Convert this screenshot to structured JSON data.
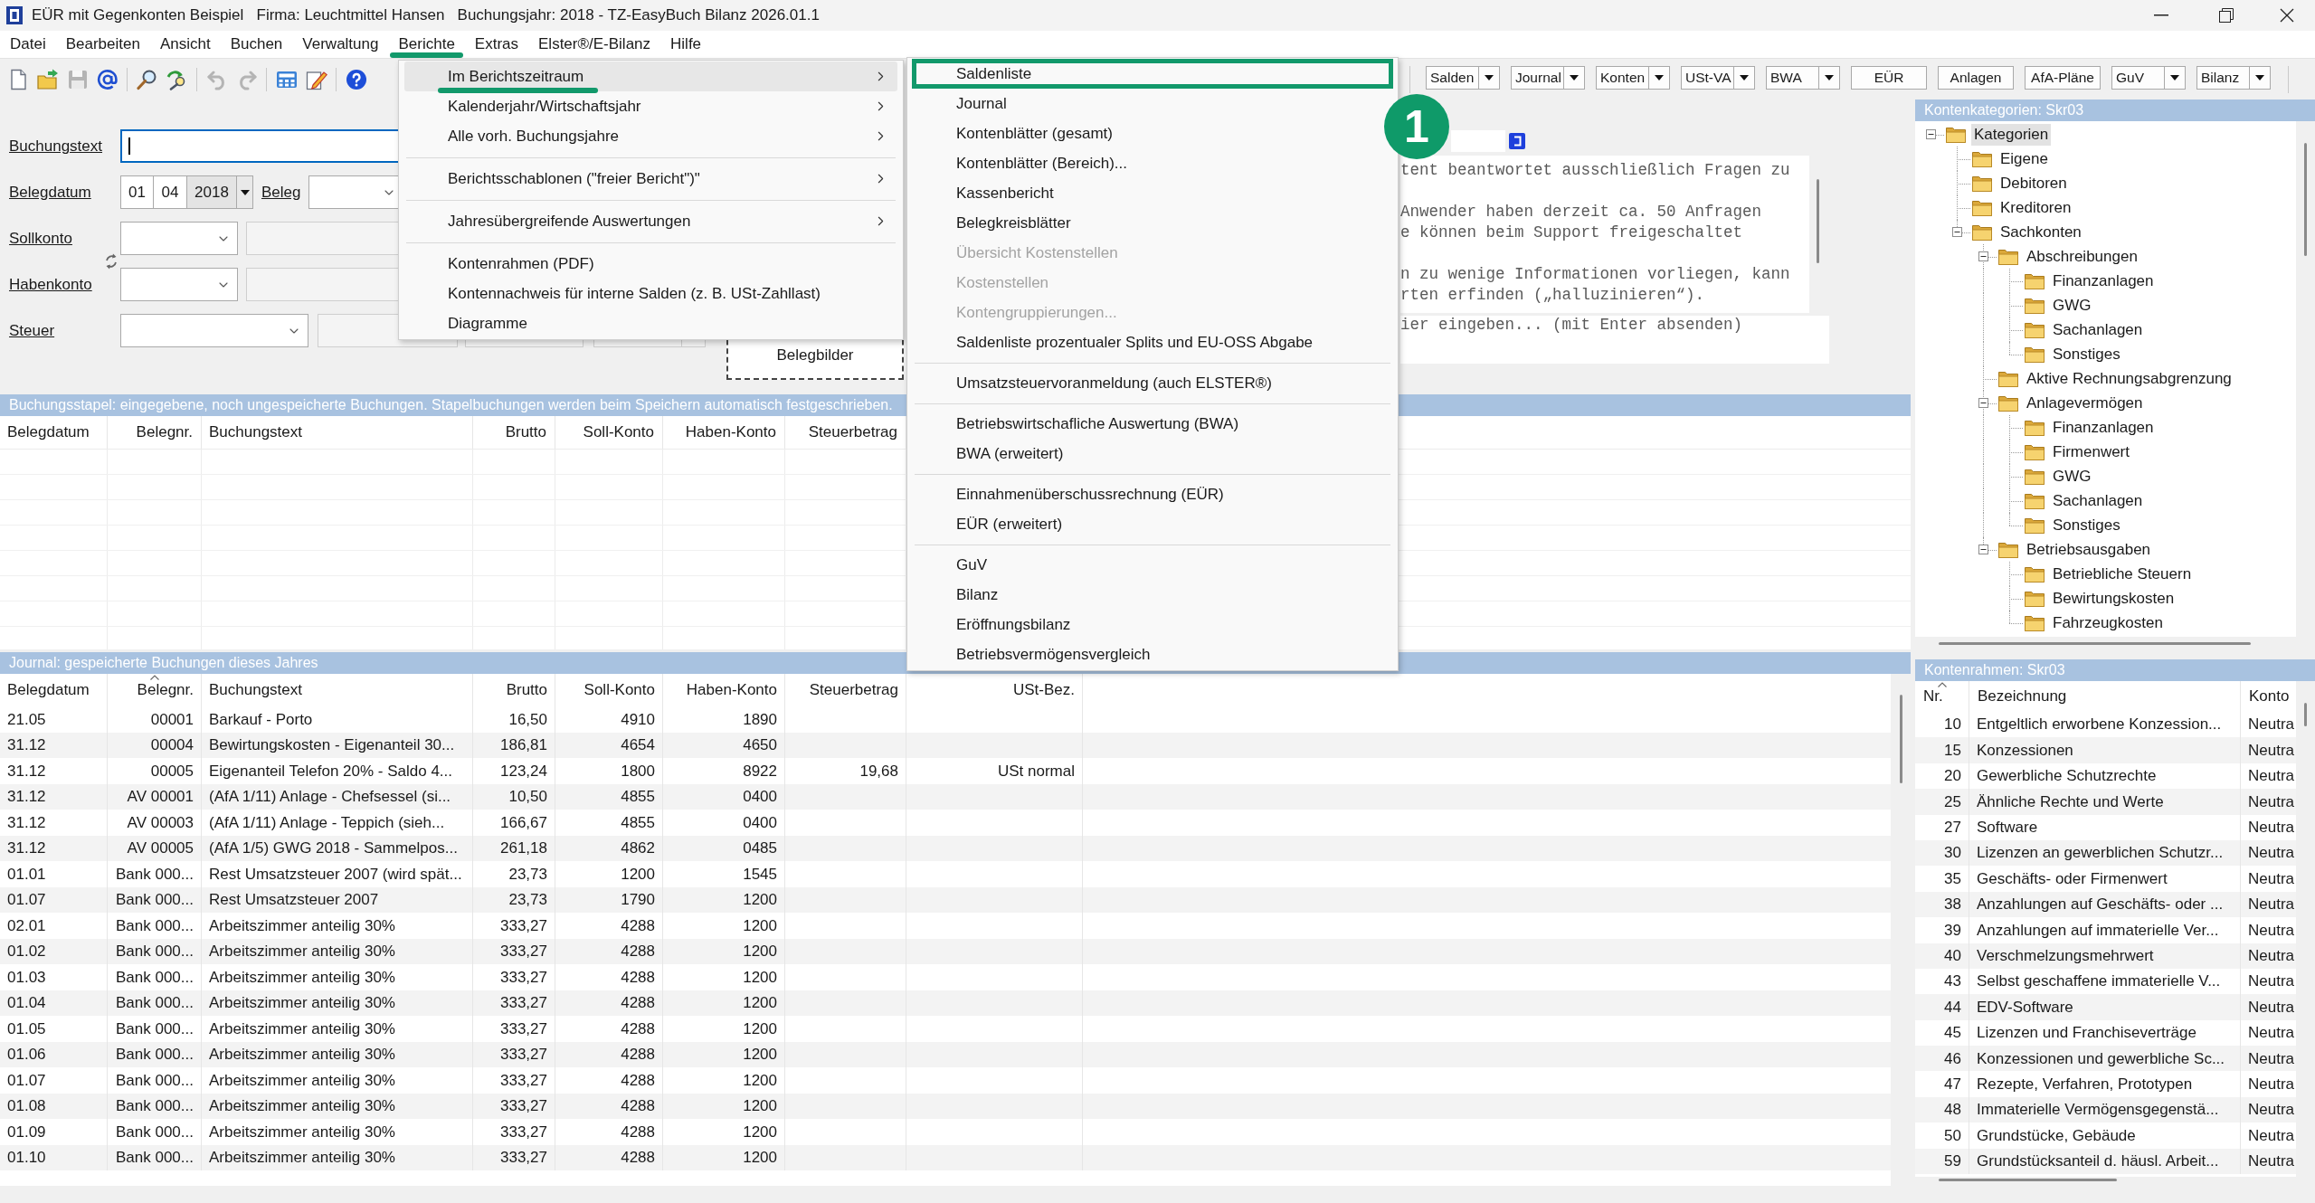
{
  "window": {
    "title": "EÜR mit Gegenkonten Beispiel   Firma: Leuchtmittel Hansen   Buchungsjahr: 2018 - TZ-EasyBuch Bilanz 2026.01.1"
  },
  "menubar": [
    {
      "label": "Datei",
      "marked": false
    },
    {
      "label": "Bearbeiten",
      "marked": false
    },
    {
      "label": "Ansicht",
      "marked": false
    },
    {
      "label": "Buchen",
      "marked": false
    },
    {
      "label": "Verwaltung",
      "marked": false
    },
    {
      "label": "Berichte",
      "marked": true
    },
    {
      "label": "Extras",
      "marked": false
    },
    {
      "label": "Elster®/E-Bilanz",
      "marked": false
    },
    {
      "label": "Hilfe",
      "marked": false
    }
  ],
  "toolbar": [
    [
      {
        "kind": "new",
        "disabled": false
      },
      {
        "kind": "open",
        "disabled": false
      },
      {
        "kind": "save",
        "disabled": true
      },
      {
        "kind": "email",
        "disabled": false
      }
    ],
    [
      {
        "kind": "find",
        "disabled": false
      },
      {
        "kind": "wizard",
        "disabled": false
      }
    ],
    [
      {
        "kind": "undo",
        "disabled": true
      },
      {
        "kind": "redo",
        "disabled": true
      }
    ],
    [
      {
        "kind": "calculator",
        "disabled": false
      },
      {
        "kind": "edit",
        "disabled": false
      }
    ],
    [
      {
        "kind": "help",
        "disabled": false
      }
    ]
  ],
  "report_buttons": [
    {
      "label": "Salden",
      "dropdown": true
    },
    {
      "label": "Journal",
      "dropdown": true
    },
    {
      "label": "Konten",
      "dropdown": true
    },
    {
      "label": "USt-VA",
      "dropdown": true
    },
    {
      "label": "BWA",
      "dropdown": true
    },
    {
      "label": "EÜR",
      "dropdown": false
    },
    {
      "label": "Anlagen",
      "dropdown": false
    },
    {
      "label": "AfA-Pläne",
      "dropdown": false
    },
    {
      "label": "GuV",
      "dropdown": true
    },
    {
      "label": "Bilanz",
      "dropdown": true
    }
  ],
  "form": {
    "booking_text": {
      "label": "Buchungstext",
      "focused": true
    },
    "receipt_date": {
      "label": "Belegdatum",
      "day": "01",
      "month": "04",
      "year": "2018"
    },
    "receipt": {
      "label": "Beleg"
    },
    "debit_account": {
      "label": "Sollkonto"
    },
    "credit_account": {
      "label": "Habenkonto"
    },
    "tax": {
      "label": "Steuer"
    },
    "receipt_images": {
      "label": "Belegbilder"
    }
  },
  "assistant": {
    "paragraphs": [
      [
        "tent beantwortet ausschließlich Fragen zu"
      ],
      [
        "Anwender haben derzeit ca. 50 Anfragen",
        "e können beim Support freigeschaltet"
      ],
      [
        "n zu wenige Informationen vorliegen, kann",
        "rten erfinden („halluzinieren“)."
      ]
    ],
    "input": {
      "placeholder": "ier eingeben... (mit Enter absenden)"
    }
  },
  "batch": {
    "title": "Buchungsstapel: eingegebene, noch ungespeicherte Buchungen. Stapelbuchungen werden beim Speichern automatisch festgeschrieben.",
    "columns": [
      "Belegdatum",
      "Belegnr.",
      "Buchungstext",
      "Brutto",
      "Soll-Konto",
      "Haben-Konto",
      "Steuerbetrag"
    ]
  },
  "journal": {
    "title": "Journal: gespeicherte Buchungen dieses Jahres",
    "columns": [
      {
        "label": "Belegdatum",
        "sorted": false
      },
      {
        "label": "Belegnr.",
        "sorted": true
      },
      {
        "label": "Buchungstext",
        "sorted": false
      },
      {
        "label": "Brutto",
        "sorted": false
      },
      {
        "label": "Soll-Konto",
        "sorted": false
      },
      {
        "label": "Haben-Konto",
        "sorted": false
      },
      {
        "label": "Steuerbetrag",
        "sorted": false
      },
      {
        "label": "USt-Bez.",
        "sorted": false
      }
    ],
    "rows": [
      {
        "date": "21.05",
        "number": "00001",
        "text": "Barkauf - Porto",
        "gross": "16,50",
        "debit": "4910",
        "credit": "1890"
      },
      {
        "date": "31.12",
        "number": "00004",
        "text": "Bewirtungskosten - Eigenanteil 30...",
        "gross": "186,81",
        "debit": "4654",
        "credit": "4650"
      },
      {
        "date": "31.12",
        "number": "00005",
        "text": "Eigenanteil Telefon 20% - Saldo 4...",
        "gross": "123,24",
        "debit": "1800",
        "credit": "8922",
        "tax": "19,68",
        "tax_code": "USt normal"
      },
      {
        "date": "31.12",
        "number": "AV 00001",
        "text": "(AfA 1/11) Anlage - Chefsessel (si...",
        "gross": "10,50",
        "debit": "4855",
        "credit": "0400"
      },
      {
        "date": "31.12",
        "number": "AV 00003",
        "text": "(AfA 1/11) Anlage - Teppich (sieh...",
        "gross": "166,67",
        "debit": "4855",
        "credit": "0400"
      },
      {
        "date": "31.12",
        "number": "AV 00005",
        "text": "(AfA 1/5) GWG 2018 - Sammelpos...",
        "gross": "261,18",
        "debit": "4862",
        "credit": "0485"
      },
      {
        "date": "01.01",
        "number": "Bank 000...",
        "text": "Rest Umsatzsteuer 2007 (wird spät...",
        "gross": "23,73",
        "debit": "1200",
        "credit": "1545"
      },
      {
        "date": "01.07",
        "number": "Bank 000...",
        "text": "Rest Umsatzsteuer 2007",
        "gross": "23,73",
        "debit": "1790",
        "credit": "1200"
      },
      {
        "date": "02.01",
        "number": "Bank 000...",
        "text": "Arbeitszimmer anteilig 30%",
        "gross": "333,27",
        "debit": "4288",
        "credit": "1200"
      },
      {
        "date": "01.02",
        "number": "Bank 000...",
        "text": "Arbeitszimmer anteilig 30%",
        "gross": "333,27",
        "debit": "4288",
        "credit": "1200"
      },
      {
        "date": "01.03",
        "number": "Bank 000...",
        "text": "Arbeitszimmer anteilig 30%",
        "gross": "333,27",
        "debit": "4288",
        "credit": "1200"
      },
      {
        "date": "01.04",
        "number": "Bank 000...",
        "text": "Arbeitszimmer anteilig 30%",
        "gross": "333,27",
        "debit": "4288",
        "credit": "1200"
      },
      {
        "date": "01.05",
        "number": "Bank 000...",
        "text": "Arbeitszimmer anteilig 30%",
        "gross": "333,27",
        "debit": "4288",
        "credit": "1200"
      },
      {
        "date": "01.06",
        "number": "Bank 000...",
        "text": "Arbeitszimmer anteilig 30%",
        "gross": "333,27",
        "debit": "4288",
        "credit": "1200"
      },
      {
        "date": "01.07",
        "number": "Bank 000...",
        "text": "Arbeitszimmer anteilig 30%",
        "gross": "333,27",
        "debit": "4288",
        "credit": "1200"
      },
      {
        "date": "01.08",
        "number": "Bank 000...",
        "text": "Arbeitszimmer anteilig 30%",
        "gross": "333,27",
        "debit": "4288",
        "credit": "1200"
      },
      {
        "date": "01.09",
        "number": "Bank 000...",
        "text": "Arbeitszimmer anteilig 30%",
        "gross": "333,27",
        "debit": "4288",
        "credit": "1200"
      },
      {
        "date": "01.10",
        "number": "Bank 000...",
        "text": "Arbeitszimmer anteilig 30%",
        "gross": "333,27",
        "debit": "4288",
        "credit": "1200"
      }
    ]
  },
  "categories": {
    "title": "Kontenkategorien: Skr03",
    "tree": [
      {
        "label": "Kategorien",
        "selected": true,
        "expanded": true,
        "children": [
          {
            "label": "Eigene",
            "selected": false
          },
          {
            "label": "Debitoren",
            "selected": false
          },
          {
            "label": "Kreditoren",
            "selected": false
          },
          {
            "label": "Sachkonten",
            "selected": false,
            "expanded": true,
            "children": [
              {
                "label": "Abschreibungen",
                "selected": false,
                "expanded": true,
                "children": [
                  {
                    "label": "Finanzanlagen",
                    "selected": false
                  },
                  {
                    "label": "GWG",
                    "selected": false
                  },
                  {
                    "label": "Sachanlagen",
                    "selected": false
                  },
                  {
                    "label": "Sonstiges",
                    "selected": false
                  }
                ]
              },
              {
                "label": "Aktive Rechnungsabgrenzung",
                "selected": false
              },
              {
                "label": "Anlagevermögen",
                "selected": false,
                "expanded": true,
                "children": [
                  {
                    "label": "Finanzanlagen",
                    "selected": false
                  },
                  {
                    "label": "Firmenwert",
                    "selected": false
                  },
                  {
                    "label": "GWG",
                    "selected": false
                  },
                  {
                    "label": "Sachanlagen",
                    "selected": false
                  },
                  {
                    "label": "Sonstiges",
                    "selected": false
                  }
                ]
              },
              {
                "label": "Betriebsausgaben",
                "selected": false,
                "expanded": true,
                "children": [
                  {
                    "label": "Betriebliche Steuern",
                    "selected": false
                  },
                  {
                    "label": "Bewirtungskosten",
                    "selected": false
                  },
                  {
                    "label": "Fahrzeugkosten",
                    "selected": false
                  }
                ]
              }
            ]
          }
        ]
      }
    ]
  },
  "chart_of_accounts": {
    "title": "Kontenrahmen: Skr03",
    "columns": [
      {
        "label": "Nr.",
        "sorted": true
      },
      {
        "label": "Bezeichnung",
        "sorted": false
      },
      {
        "label": "Konto",
        "sorted": false
      }
    ],
    "rows": [
      {
        "number": "10",
        "name": "Entgeltlich erworbene Konzession...",
        "column_3": "Neutra"
      },
      {
        "number": "15",
        "name": "Konzessionen",
        "column_3": "Neutra"
      },
      {
        "number": "20",
        "name": "Gewerbliche Schutzrechte",
        "column_3": "Neutra"
      },
      {
        "number": "25",
        "name": "Ähnliche Rechte und Werte",
        "column_3": "Neutra"
      },
      {
        "number": "27",
        "name": "Software",
        "column_3": "Neutra"
      },
      {
        "number": "30",
        "name": "Lizenzen an gewerblichen Schutzr...",
        "column_3": "Neutra"
      },
      {
        "number": "35",
        "name": "Geschäfts- oder Firmenwert",
        "column_3": "Neutra"
      },
      {
        "number": "38",
        "name": "Anzahlungen auf Geschäfts- oder ...",
        "column_3": "Neutra"
      },
      {
        "number": "39",
        "name": "Anzahlungen auf immaterielle Ver...",
        "column_3": "Neutra"
      },
      {
        "number": "40",
        "name": "Verschmelzungsmehrwert",
        "column_3": "Neutra"
      },
      {
        "number": "43",
        "name": "Selbst geschaffene immaterielle V...",
        "column_3": "Neutra"
      },
      {
        "number": "44",
        "name": "EDV-Software",
        "column_3": "Neutra"
      },
      {
        "number": "45",
        "name": "Lizenzen und Franchiseverträge",
        "column_3": "Neutra"
      },
      {
        "number": "46",
        "name": "Konzessionen und gewerbliche Sc...",
        "column_3": "Neutra"
      },
      {
        "number": "47",
        "name": "Rezepte, Verfahren, Prototypen",
        "column_3": "Neutra"
      },
      {
        "number": "48",
        "name": "Immaterielle Vermögensgegenstä...",
        "column_3": "Neutra"
      },
      {
        "number": "50",
        "name": "Grundstücke, Gebäude",
        "column_3": "Neutra"
      },
      {
        "number": "59",
        "name": "Grundstücksanteil d. häusl. Arbeit...",
        "column_3": "Neutra"
      }
    ]
  },
  "report_menu": {
    "groups": [
      [
        {
          "label": "Im Berichtszeitraum",
          "submenu": true,
          "selected": true,
          "marked": true
        },
        {
          "label": "Kalenderjahr/Wirtschaftsjahr",
          "submenu": true,
          "selected": false,
          "marked": false
        },
        {
          "label": "Alle vorh. Buchungsjahre",
          "submenu": true,
          "selected": false,
          "marked": false
        }
      ],
      [
        {
          "label": "Berichtsschablonen (\"freier Bericht\")\"",
          "submenu": true,
          "selected": false,
          "marked": false
        }
      ],
      [
        {
          "label": "Jahresübergreifende Auswertungen",
          "submenu": true,
          "selected": false,
          "marked": false
        }
      ],
      [
        {
          "label": "Kontenrahmen (PDF)",
          "submenu": false,
          "selected": false,
          "marked": false
        },
        {
          "label": "Kontennachweis für interne Salden (z. B. USt-Zahllast)",
          "submenu": false,
          "selected": false,
          "marked": false
        },
        {
          "label": "Diagramme",
          "submenu": false,
          "selected": false,
          "marked": false
        }
      ]
    ]
  },
  "report_submenu": {
    "groups": [
      [
        {
          "label": "Saldenliste",
          "disabled": false,
          "marked": true
        },
        {
          "label": "Journal",
          "disabled": false,
          "marked": false
        },
        {
          "label": "Kontenblätter (gesamt)",
          "disabled": false,
          "marked": false
        },
        {
          "label": "Kontenblätter (Bereich)...",
          "disabled": false,
          "marked": false
        },
        {
          "label": "Kassenbericht",
          "disabled": false,
          "marked": false
        },
        {
          "label": "Belegkreisblätter",
          "disabled": false,
          "marked": false
        },
        {
          "label": "Übersicht Kostenstellen",
          "disabled": true,
          "marked": false
        },
        {
          "label": "Kostenstellen",
          "disabled": true,
          "marked": false
        },
        {
          "label": "Kontengruppierungen...",
          "disabled": true,
          "marked": false
        },
        {
          "label": "Saldenliste prozentualer Splits und EU-OSS Abgabe",
          "disabled": false,
          "marked": false
        }
      ],
      [
        {
          "label": "Umsatzsteuervoranmeldung (auch ELSTER®)",
          "disabled": false,
          "marked": false
        }
      ],
      [
        {
          "label": "Betriebswirtschafliche Auswertung (BWA)",
          "disabled": false,
          "marked": false
        },
        {
          "label": "BWA (erweitert)",
          "disabled": false,
          "marked": false
        }
      ],
      [
        {
          "label": "Einnahmenüberschussrechnung (EÜR)",
          "disabled": false,
          "marked": false
        },
        {
          "label": "EÜR (erweitert)",
          "disabled": false,
          "marked": false
        }
      ],
      [
        {
          "label": "GuV",
          "disabled": false,
          "marked": false
        },
        {
          "label": "Bilanz",
          "disabled": false,
          "marked": false
        },
        {
          "label": "Eröffnungsbilanz",
          "disabled": false,
          "marked": false
        },
        {
          "label": "Betriebsvermögensvergleich",
          "disabled": false,
          "marked": false
        }
      ]
    ]
  },
  "step_marker": {
    "label": "1"
  }
}
